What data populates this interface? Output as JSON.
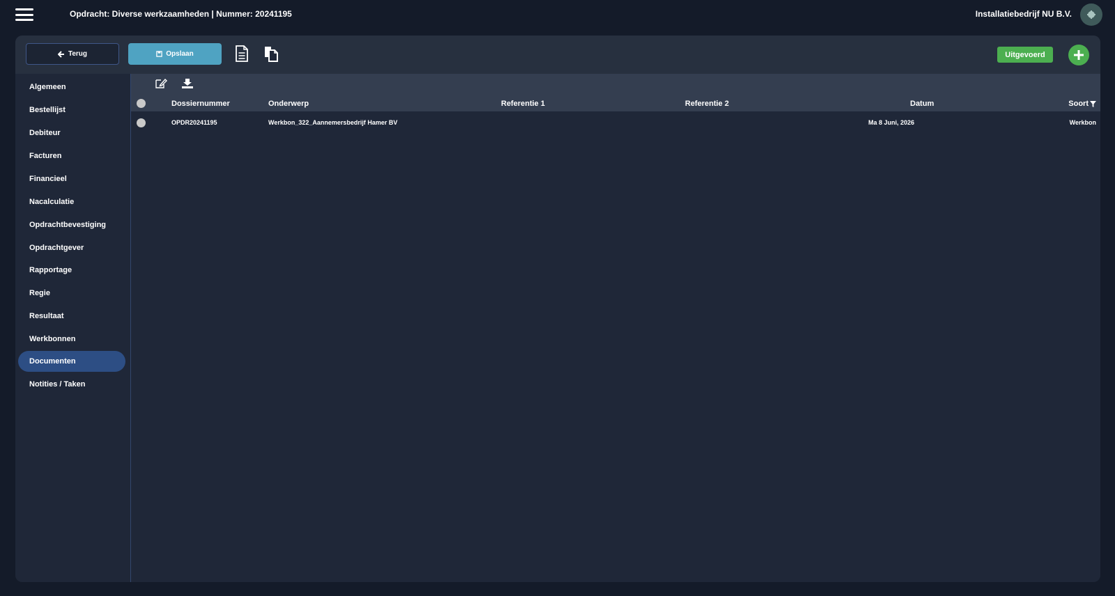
{
  "header": {
    "title": "Opdracht: Diverse werkzaamheden | Nummer: 20241195",
    "company": "Installatiebedrijf NU B.V."
  },
  "toolbar": {
    "back_label": "Terug",
    "save_label": "Opslaan",
    "status_label": "Uitgevoerd"
  },
  "sidebar": {
    "items": [
      {
        "label": "Algemeen"
      },
      {
        "label": "Bestellijst"
      },
      {
        "label": "Debiteur"
      },
      {
        "label": "Facturen"
      },
      {
        "label": "Financieel"
      },
      {
        "label": "Nacalculatie"
      },
      {
        "label": "Opdrachtbevestiging"
      },
      {
        "label": "Opdrachtgever"
      },
      {
        "label": "Rapportage"
      },
      {
        "label": "Regie"
      },
      {
        "label": "Resultaat"
      },
      {
        "label": "Werkbonnen"
      },
      {
        "label": "Documenten",
        "active": true
      },
      {
        "label": "Notities / Taken"
      }
    ]
  },
  "table": {
    "columns": {
      "dossiernummer": "Dossiernummer",
      "onderwerp": "Onderwerp",
      "referentie1": "Referentie 1",
      "referentie2": "Referentie 2",
      "datum": "Datum",
      "soort": "Soort"
    },
    "rows": [
      {
        "dossiernummer": "OPDR20241195",
        "onderwerp": "Werkbon_322_Aannemersbedrijf Hamer BV",
        "referentie1": "",
        "referentie2": "",
        "datum": "Ma 8 Juni, 2026",
        "soort": "Werkbon"
      }
    ]
  },
  "colors": {
    "background": "#141b29",
    "panel": "#1f2738",
    "save": "#4fa3c2",
    "status": "#4caf50",
    "active_nav": "#2d4e84"
  }
}
